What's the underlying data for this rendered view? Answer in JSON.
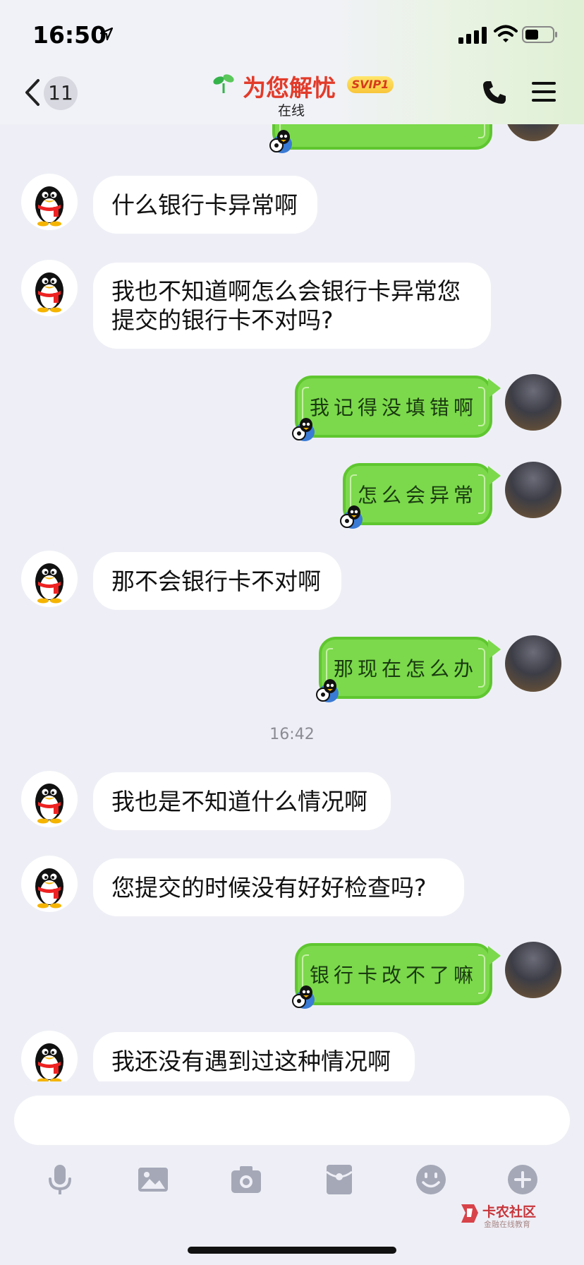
{
  "status_bar": {
    "time": "16:50"
  },
  "header": {
    "back_count": "11",
    "title": "为您解忧",
    "badge": "SVIP1",
    "status": "在线"
  },
  "messages": [
    {
      "side": "in",
      "text": "什么银行卡异常啊"
    },
    {
      "side": "in",
      "text": "我也不知道啊怎么会银行卡异常您提交的银行卡不对吗?"
    },
    {
      "side": "out",
      "text": "我记得没填错啊"
    },
    {
      "side": "out",
      "text": "怎么会异常"
    },
    {
      "side": "in",
      "text": "那不会银行卡不对啊"
    },
    {
      "side": "out",
      "text": "那现在怎么办"
    },
    {
      "side": "in",
      "text": "我也是不知道什么情况啊"
    },
    {
      "side": "in",
      "text": "您提交的时候没有好好检查吗?"
    },
    {
      "side": "out",
      "text": "银行卡改不了嘛"
    },
    {
      "side": "in",
      "text": "我还没有遇到过这种情况啊"
    }
  ],
  "timestamp": "16:42",
  "toolbar": [
    "microphone-icon",
    "image-icon",
    "camera-icon",
    "red-packet-icon",
    "emoji-icon",
    "plus-icon"
  ],
  "watermark": {
    "name": "卡农社区",
    "sub": "金融在线教育"
  },
  "colors": {
    "accent_title": "#e23b2a",
    "bubble_out": "#7bd94b",
    "toolbar_icon": "#a5a8b7"
  }
}
